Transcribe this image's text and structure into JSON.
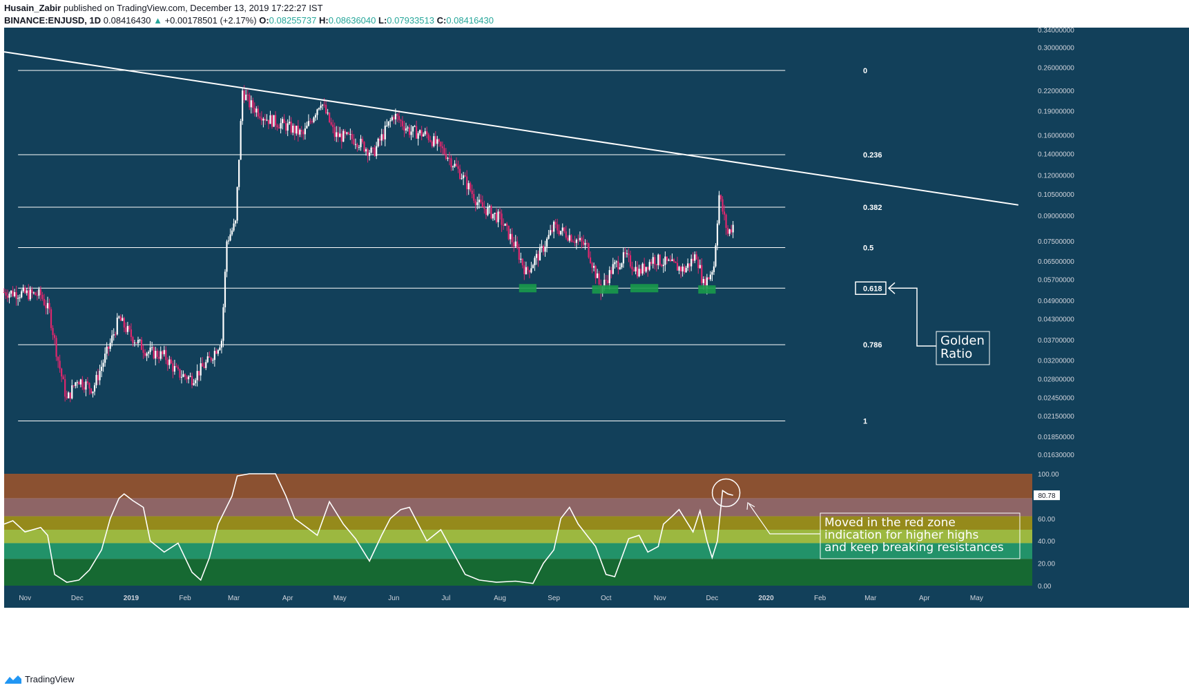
{
  "header": {
    "author": "Husain_Zabir",
    "published": "published on TradingView.com, December 13, 2019 17:22:27 IST",
    "symbol": "BINANCE:ENJUSD, 1D",
    "last": "0.08416430",
    "change": "+0.00178501 (+2.17%)",
    "o_label": "O:",
    "o": "0.08255737",
    "h_label": "H:",
    "h": "0.08636040",
    "l_label": "L:",
    "l": "0.07933513",
    "c_label": "C:",
    "c": "0.08416430"
  },
  "footer": {
    "brand": "TradingView"
  },
  "colors": {
    "background": "#12405a",
    "up": "#ffffff",
    "down": "#e0276e",
    "fib_line": "#ffffff",
    "zone_green": "#1a9a4a"
  },
  "chart_data": [
    {
      "type": "candlestick",
      "title": "",
      "scale": "log",
      "ylim": [
        0.0155,
        0.345
      ],
      "y_ticks": [
        "0.34000000",
        "0.30000000",
        "0.26000000",
        "0.22000000",
        "0.19000000",
        "0.16000000",
        "0.14000000",
        "0.12000000",
        "0.10500000",
        "0.09000000",
        "0.07500000",
        "0.06500000",
        "0.05700000",
        "0.04900000",
        "0.04300000",
        "0.03700000",
        "0.03200000",
        "0.02800000",
        "0.02450000",
        "0.02150000",
        "0.01850000",
        "0.01630000"
      ],
      "x_ticks": [
        "Nov",
        "Dec",
        "2019",
        "Feb",
        "Mar",
        "Apr",
        "May",
        "Jun",
        "Jul",
        "Aug",
        "Sep",
        "Oct",
        "Nov",
        "Dec",
        "2020",
        "Feb",
        "Mar",
        "Apr",
        "May"
      ],
      "price_path": [
        [
          "2018-10-20",
          0.052
        ],
        [
          "2018-11-10",
          0.051
        ],
        [
          "2018-11-15",
          0.045
        ],
        [
          "2018-11-20",
          0.032
        ],
        [
          "2018-11-25",
          0.024
        ],
        [
          "2018-12-01",
          0.028
        ],
        [
          "2018-12-10",
          0.026
        ],
        [
          "2018-12-20",
          0.036
        ],
        [
          "2018-12-25",
          0.043
        ],
        [
          "2019-01-01",
          0.038
        ],
        [
          "2019-01-10",
          0.034
        ],
        [
          "2019-01-20",
          0.033
        ],
        [
          "2019-01-28",
          0.029
        ],
        [
          "2019-02-05",
          0.028
        ],
        [
          "2019-02-15",
          0.032
        ],
        [
          "2019-02-22",
          0.037
        ],
        [
          "2019-02-25",
          0.075
        ],
        [
          "2019-03-02",
          0.085
        ],
        [
          "2019-03-06",
          0.22
        ],
        [
          "2019-03-10",
          0.2
        ],
        [
          "2019-03-20",
          0.18
        ],
        [
          "2019-04-01",
          0.17
        ],
        [
          "2019-04-10",
          0.16
        ],
        [
          "2019-04-20",
          0.205
        ],
        [
          "2019-04-28",
          0.16
        ],
        [
          "2019-05-10",
          0.155
        ],
        [
          "2019-05-20",
          0.14
        ],
        [
          "2019-06-01",
          0.185
        ],
        [
          "2019-06-10",
          0.165
        ],
        [
          "2019-06-20",
          0.16
        ],
        [
          "2019-07-01",
          0.14
        ],
        [
          "2019-07-10",
          0.12
        ],
        [
          "2019-07-20",
          0.097
        ],
        [
          "2019-08-01",
          0.088
        ],
        [
          "2019-08-10",
          0.072
        ],
        [
          "2019-08-16",
          0.06
        ],
        [
          "2019-08-25",
          0.07
        ],
        [
          "2019-09-01",
          0.083
        ],
        [
          "2019-09-10",
          0.078
        ],
        [
          "2019-09-20",
          0.072
        ],
        [
          "2019-09-28",
          0.053
        ],
        [
          "2019-10-05",
          0.062
        ],
        [
          "2019-10-12",
          0.067
        ],
        [
          "2019-10-20",
          0.06
        ],
        [
          "2019-10-28",
          0.066
        ],
        [
          "2019-11-05",
          0.064
        ],
        [
          "2019-11-15",
          0.061
        ],
        [
          "2019-11-22",
          0.068
        ],
        [
          "2019-11-26",
          0.055
        ],
        [
          "2019-11-29",
          0.058
        ],
        [
          "2019-12-02",
          0.063
        ],
        [
          "2019-12-05",
          0.104
        ],
        [
          "2019-12-08",
          0.088
        ],
        [
          "2019-12-10",
          0.079
        ],
        [
          "2019-12-13",
          0.084
        ]
      ],
      "trendline": {
        "from": [
          "2018-10-20",
          0.29
        ],
        "to": [
          "2020-05-25",
          0.097
        ]
      },
      "fib_levels": [
        {
          "label": "0",
          "price": 0.254
        },
        {
          "label": "0.236",
          "price": 0.139
        },
        {
          "label": "0.382",
          "price": 0.0955
        },
        {
          "label": "0.5",
          "price": 0.0715
        },
        {
          "label": "0.618",
          "price": 0.0535
        },
        {
          "label": "0.786",
          "price": 0.0357
        },
        {
          "label": "1",
          "price": 0.0207
        }
      ],
      "support_zones": [
        {
          "from": "2019-08-12",
          "to": "2019-08-22",
          "price": 0.0535
        },
        {
          "from": "2019-09-23",
          "to": "2019-10-08",
          "price": 0.053
        },
        {
          "from": "2019-10-15",
          "to": "2019-10-31",
          "price": 0.0535
        },
        {
          "from": "2019-11-23",
          "to": "2019-12-03",
          "price": 0.053
        }
      ],
      "annotation": "Golden\nRatio"
    },
    {
      "type": "line",
      "title": "",
      "ylim": [
        0,
        100
      ],
      "y_ticks": [
        "100.00",
        "80.00",
        "60.00",
        "40.00",
        "20.00",
        "0.00"
      ],
      "current_value": "80.78",
      "bands": [
        {
          "from": 78,
          "to": 100,
          "color": "#8b5131"
        },
        {
          "from": 62,
          "to": 78,
          "color": "#8e6566"
        },
        {
          "from": 50,
          "to": 62,
          "color": "#958a1b"
        },
        {
          "from": 38,
          "to": 50,
          "color": "#9cb840"
        },
        {
          "from": 24,
          "to": 38,
          "color": "#229269"
        },
        {
          "from": 0,
          "to": 24,
          "color": "#166932"
        }
      ],
      "series": [
        {
          "values": [
            [
              "2018-10-20",
              55
            ],
            [
              "2018-10-25",
              58
            ],
            [
              "2018-11-01",
              48
            ],
            [
              "2018-11-10",
              52
            ],
            [
              "2018-11-14",
              45
            ],
            [
              "2018-11-18",
              10
            ],
            [
              "2018-11-25",
              3
            ],
            [
              "2018-12-02",
              5
            ],
            [
              "2018-12-08",
              14
            ],
            [
              "2018-12-15",
              32
            ],
            [
              "2018-12-20",
              60
            ],
            [
              "2018-12-25",
              78
            ],
            [
              "2018-12-28",
              82
            ],
            [
              "2019-01-02",
              76
            ],
            [
              "2019-01-08",
              70
            ],
            [
              "2019-01-12",
              40
            ],
            [
              "2019-01-20",
              30
            ],
            [
              "2019-01-28",
              38
            ],
            [
              "2019-02-05",
              12
            ],
            [
              "2019-02-10",
              5
            ],
            [
              "2019-02-15",
              25
            ],
            [
              "2019-02-20",
              55
            ],
            [
              "2019-02-28",
              80
            ],
            [
              "2019-03-03",
              98
            ],
            [
              "2019-03-10",
              100
            ],
            [
              "2019-03-25",
              100
            ],
            [
              "2019-03-31",
              80
            ],
            [
              "2019-04-05",
              60
            ],
            [
              "2019-04-12",
              52
            ],
            [
              "2019-04-18",
              45
            ],
            [
              "2019-04-25",
              75
            ],
            [
              "2019-05-03",
              55
            ],
            [
              "2019-05-10",
              42
            ],
            [
              "2019-05-18",
              22
            ],
            [
              "2019-05-25",
              45
            ],
            [
              "2019-05-30",
              60
            ],
            [
              "2019-06-05",
              68
            ],
            [
              "2019-06-10",
              70
            ],
            [
              "2019-06-15",
              55
            ],
            [
              "2019-06-20",
              40
            ],
            [
              "2019-06-28",
              50
            ],
            [
              "2019-07-05",
              30
            ],
            [
              "2019-07-12",
              10
            ],
            [
              "2019-07-20",
              5
            ],
            [
              "2019-07-30",
              3
            ],
            [
              "2019-08-10",
              4
            ],
            [
              "2019-08-20",
              2
            ],
            [
              "2019-08-26",
              20
            ],
            [
              "2019-09-01",
              32
            ],
            [
              "2019-09-05",
              60
            ],
            [
              "2019-09-10",
              70
            ],
            [
              "2019-09-15",
              55
            ],
            [
              "2019-09-20",
              45
            ],
            [
              "2019-09-25",
              35
            ],
            [
              "2019-10-01",
              10
            ],
            [
              "2019-10-06",
              8
            ],
            [
              "2019-10-10",
              25
            ],
            [
              "2019-10-14",
              42
            ],
            [
              "2019-10-20",
              45
            ],
            [
              "2019-10-25",
              30
            ],
            [
              "2019-10-31",
              35
            ],
            [
              "2019-11-03",
              55
            ],
            [
              "2019-11-08",
              62
            ],
            [
              "2019-11-12",
              68
            ],
            [
              "2019-11-16",
              58
            ],
            [
              "2019-11-20",
              48
            ],
            [
              "2019-11-24",
              67
            ],
            [
              "2019-11-28",
              40
            ],
            [
              "2019-12-01",
              25
            ],
            [
              "2019-12-04",
              40
            ],
            [
              "2019-12-07",
              85
            ],
            [
              "2019-12-10",
              82
            ],
            [
              "2019-12-13",
              80.78
            ]
          ]
        }
      ],
      "annotation": "Moved in the red zone\nindication for higher highs\nand keep breaking resistances"
    }
  ]
}
